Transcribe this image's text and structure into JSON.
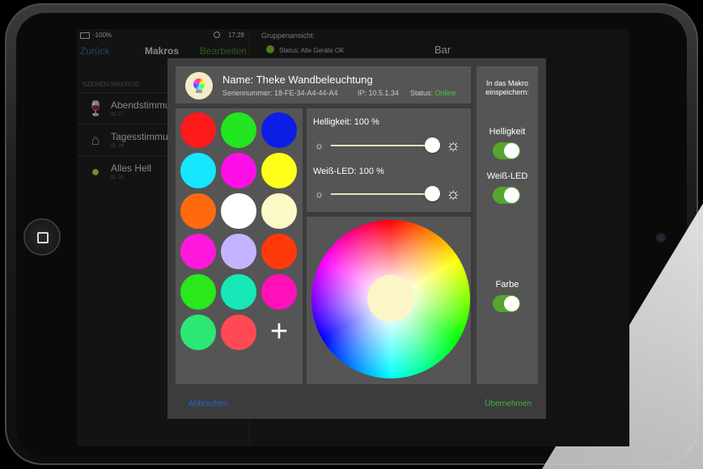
{
  "status_bar": {
    "battery": "-100%",
    "time": "17:28"
  },
  "left_nav": {
    "back": "Zurück",
    "title": "Makros",
    "edit": "Bearbeiten"
  },
  "section_header": "SZENEN-MAKROS",
  "macros": [
    {
      "name": "Abendstimmung",
      "id": "ID: 27",
      "icon": "wine-glass-icon"
    },
    {
      "name": "Tagesstimmung",
      "id": "ID: 28",
      "icon": "house-icon"
    },
    {
      "name": "Alles Hell",
      "id": "ID: 31",
      "icon": "bulb-icon"
    }
  ],
  "group_view": {
    "label": "Gruppenansicht:",
    "status": "Status: Alle Geräte OK",
    "title": "Bar"
  },
  "device": {
    "name": "Name: Theke Wandbeleuchtung",
    "serial": "Seriennummer: 18-FE-34-A4-44-A4",
    "ip": "IP: 10.5.1.34",
    "status_label": "Status:",
    "status_value": "Online"
  },
  "swatches": [
    "#ff1a1a",
    "#22e61f",
    "#0b1ee6",
    "#16e6ff",
    "#ff0fe8",
    "#ffff1a",
    "#ff6a10",
    "#ffffff",
    "#fbfac6",
    "#ff18dc",
    "#c4b4ff",
    "#ff3a0a",
    "#29e81c",
    "#16e8b8",
    "#ff10b8",
    "#2be873",
    "#ff4a55"
  ],
  "brightness": {
    "label": "Helligkeit:",
    "value": "100 %",
    "level": 1.0
  },
  "white_led": {
    "label": "Weiß-LED:",
    "value": "100 %",
    "level": 1.0
  },
  "save_panel": {
    "heading": "In das Makro einspeichern:",
    "toggles": [
      {
        "label": "Helligkeit",
        "on": true
      },
      {
        "label": "Weiß-LED",
        "on": true
      },
      {
        "label": "Farbe",
        "on": true
      }
    ]
  },
  "footer": {
    "cancel": "Abbrechen",
    "accept": "Übernehmen"
  },
  "colors": {
    "accent_green": "#55a52f",
    "link_blue": "#1e68c6",
    "online_green": "#3bd23b"
  }
}
